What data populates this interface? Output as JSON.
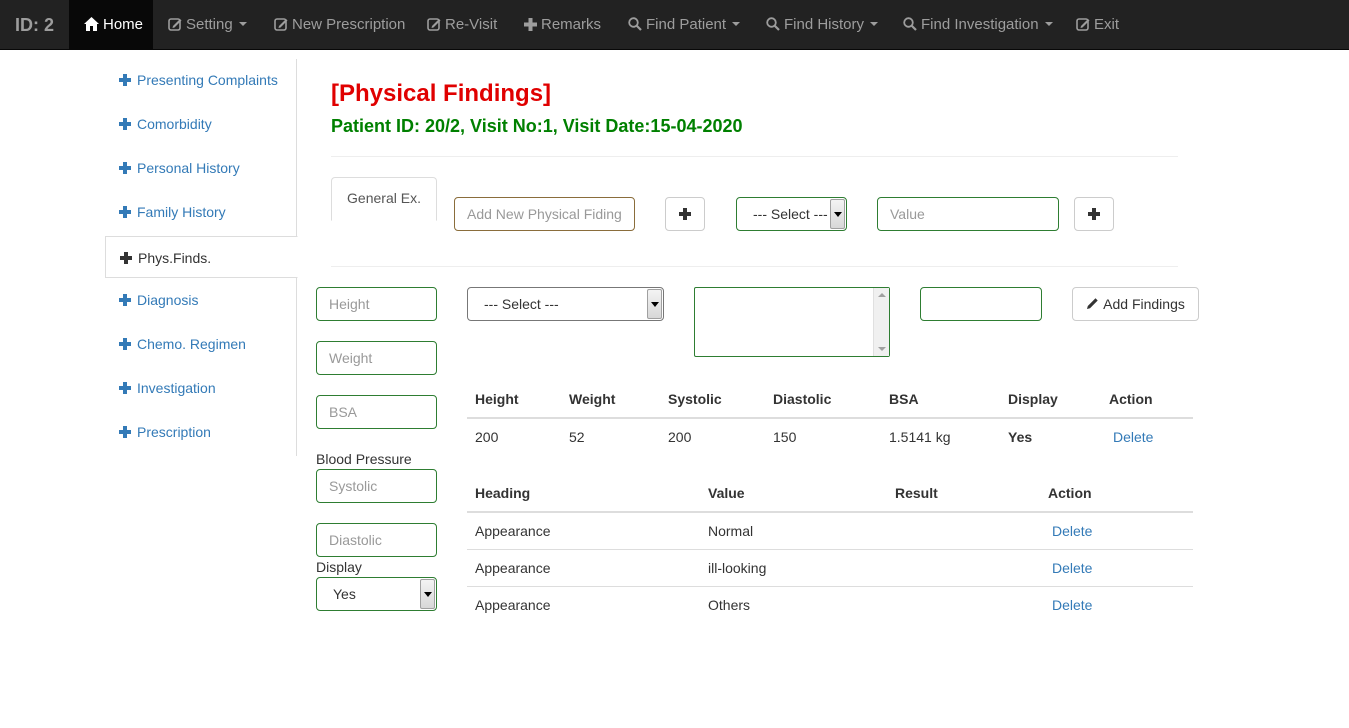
{
  "navbar": {
    "brand": "ID: 2",
    "items": [
      {
        "label": "Home",
        "icon": "home-icon"
      },
      {
        "label": "Setting",
        "icon": "edit-icon",
        "dropdown": true
      },
      {
        "label": "New Prescription",
        "icon": "edit-icon"
      },
      {
        "label": "Re-Visit",
        "icon": "edit-icon"
      },
      {
        "label": "Remarks",
        "icon": "plus-icon"
      },
      {
        "label": "Find Patient",
        "icon": "search-icon",
        "dropdown": true
      },
      {
        "label": "Find History",
        "icon": "search-icon",
        "dropdown": true
      },
      {
        "label": "Find Investigation",
        "icon": "search-icon",
        "dropdown": true
      },
      {
        "label": "Exit",
        "icon": "edit-icon"
      }
    ]
  },
  "sidebar": {
    "items": [
      {
        "label": "Presenting Complaints"
      },
      {
        "label": "Comorbidity"
      },
      {
        "label": "Personal History"
      },
      {
        "label": "Family History"
      },
      {
        "label": "Phys.Finds.",
        "active": true
      },
      {
        "label": "Diagnosis"
      },
      {
        "label": "Chemo. Regimen"
      },
      {
        "label": "Investigation"
      },
      {
        "label": "Prescription"
      }
    ]
  },
  "page": {
    "title": "[Physical Findings]",
    "subtitle": "Patient ID: 20/2,  Visit No:1, Visit Date:15-04-2020"
  },
  "tab": {
    "label": "General Ex."
  },
  "finding_form": {
    "new_finding_placeholder": "Add New Physical Fiding",
    "select_value": "--- Select ---",
    "value_placeholder": "Value"
  },
  "vitals_form": {
    "height_placeholder": "Height",
    "weight_placeholder": "Weight",
    "bsa_placeholder": "BSA",
    "blood_pressure_label": "Blood Pressure",
    "systolic_placeholder": "Systolic",
    "diastolic_placeholder": "Diastolic",
    "display_label": "Display",
    "display_value": "Yes",
    "select_value": "--- Select ---",
    "add_findings_label": "Add Findings"
  },
  "vitals_table": {
    "headers": [
      "Height",
      "Weight",
      "Systolic",
      "Diastolic",
      "BSA",
      "Display",
      "Action"
    ],
    "rows": [
      {
        "height": "200",
        "weight": "52",
        "systolic": "200",
        "diastolic": "150",
        "bsa": "1.5141 kg",
        "display": "Yes",
        "action": "Delete"
      }
    ]
  },
  "findings_table": {
    "headers": [
      "Heading",
      "Value",
      "Result",
      "Action"
    ],
    "rows": [
      {
        "heading": "Appearance",
        "value": "Normal",
        "result": "",
        "action": "Delete"
      },
      {
        "heading": "Appearance",
        "value": "ill-looking",
        "result": "",
        "action": "Delete"
      },
      {
        "heading": "Appearance",
        "value": "Others",
        "result": "",
        "action": "Delete"
      }
    ]
  },
  "colors": {
    "navbar_bg": "#222222",
    "title_red": "#e00000",
    "subtitle_green": "#008000",
    "link_blue": "#337ab7",
    "input_border_green": "#2e7d32"
  }
}
